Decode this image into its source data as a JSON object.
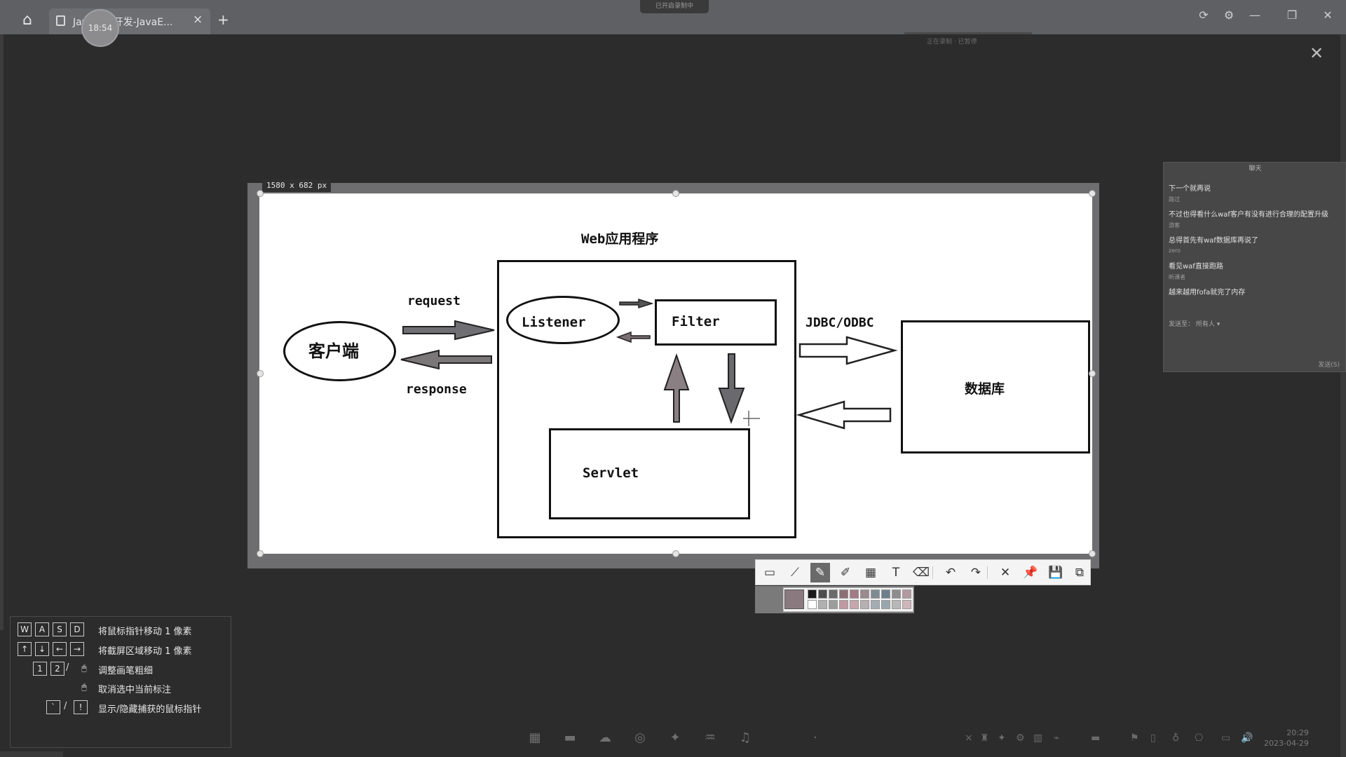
{
  "window": {
    "tab_title": "Java安全开发-JavaE...",
    "tab_close": "×",
    "tab_add": "+",
    "timer": "18:54",
    "capture_hint": "已开启录制中",
    "top_hint": "正在录制 · 已暂停",
    "buttons": {
      "refresh": "⟳",
      "settings": "⚙",
      "minimize": "—",
      "restore": "❐",
      "close": "✕"
    },
    "overlay_close": "✕"
  },
  "capture": {
    "size_label": "1580 x 682  px"
  },
  "diagram": {
    "title": "Web应用程序",
    "client": "客户端",
    "request": "request",
    "response": "response",
    "listener": "Listener",
    "filter": "Filter",
    "servlet": "Servlet",
    "jdbc": "JDBC/ODBC",
    "database": "数据库"
  },
  "toolbar": {
    "tools": [
      {
        "name": "rectangle-tool",
        "icon": "▭"
      },
      {
        "name": "polyline-tool",
        "icon": "⟋"
      },
      {
        "name": "pen-tool",
        "icon": "✎"
      },
      {
        "name": "marker-tool",
        "icon": "✐"
      },
      {
        "name": "mosaic-tool",
        "icon": "▦"
      },
      {
        "name": "text-tool",
        "icon": "T"
      },
      {
        "name": "eraser-tool",
        "icon": "⌫"
      },
      {
        "name": "undo-tool",
        "icon": "↶"
      },
      {
        "name": "redo-tool",
        "icon": "↷"
      },
      {
        "name": "cancel-tool",
        "icon": "✕"
      },
      {
        "name": "pin-tool",
        "icon": "📌"
      },
      {
        "name": "save-tool",
        "icon": "💾"
      },
      {
        "name": "copy-tool",
        "icon": "⧉"
      }
    ],
    "palette_colors": [
      "#1a1a1a",
      "#4d4d4d",
      "#6b6b6b",
      "#8c6f76",
      "#a27b84",
      "#9a8a8e",
      "#7f8b93",
      "#6d7f8c",
      "#8d8d8d",
      "#b29aa0",
      "#ffffff",
      "#b0b0b0",
      "#9c9c9c",
      "#c09aa2",
      "#c7a6ad",
      "#b7b0b3",
      "#a4adb3",
      "#9aa6ae",
      "#b8b8b8",
      "#cfb6bb"
    ]
  },
  "chat": {
    "title": "聊天",
    "lines": [
      {
        "type": "msg",
        "text": "下一个就再说"
      },
      {
        "type": "name",
        "text": "路过"
      },
      {
        "type": "msg",
        "text": "不过也得看什么waf客户有没有进行合理的配置升级"
      },
      {
        "type": "name",
        "text": "游客"
      },
      {
        "type": "msg",
        "text": "总得首先有waf数据库再说了"
      },
      {
        "type": "name",
        "text": "zero"
      },
      {
        "type": "msg",
        "text": "看见waf直接跑路"
      },
      {
        "type": "name",
        "text": "听课者"
      },
      {
        "type": "msg",
        "text": "越来越用fofa就完了内存"
      }
    ],
    "footer": "发送至：  所有人 ▾",
    "send": "发送(S)"
  },
  "hints": [
    {
      "keys": [
        "W",
        "A",
        "S",
        "D"
      ],
      "text": "将鼠标指针移动 1 像素"
    },
    {
      "keys": [
        "↑",
        "↓",
        "←",
        "→"
      ],
      "text": "将截屏区域移动 1 像素"
    },
    {
      "keys": [
        "1",
        "2",
        "/",
        "🖱"
      ],
      "text": "调整画笔粗细"
    },
    {
      "keys": [
        "🖱"
      ],
      "text": "取消选中当前标注"
    },
    {
      "keys": [
        "`",
        "/",
        "!"
      ],
      "text": "显示/隐藏捕获的鼠标指针"
    }
  ],
  "taskbar": {
    "icons": [
      "▦",
      "▬",
      "☁",
      "◎",
      "✦",
      "♒",
      "♫",
      "·"
    ],
    "tray": [
      "×",
      "♜",
      "✦",
      "⚙",
      "▥",
      "⌁",
      "▬",
      "⚑",
      "▯",
      "♁",
      "⎔",
      "▭",
      "🔊"
    ],
    "time": "20:29",
    "date": "2023-04-29"
  }
}
